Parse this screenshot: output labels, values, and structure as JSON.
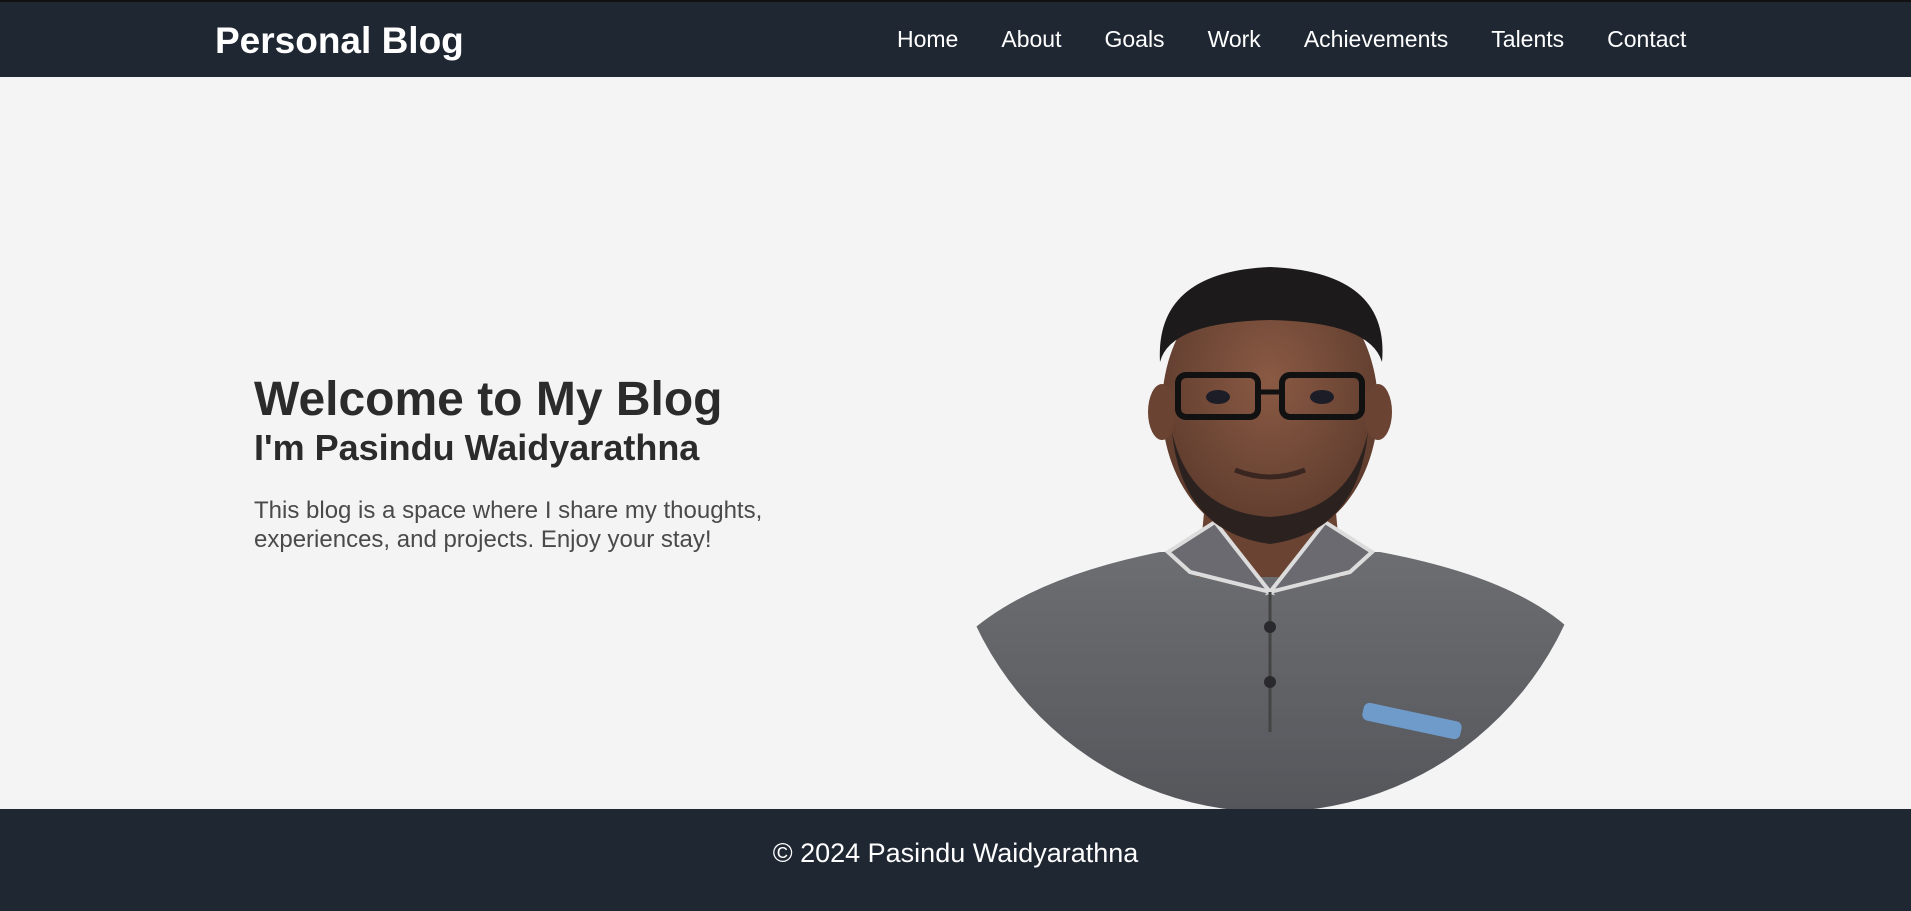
{
  "header": {
    "brand": "Personal Blog",
    "nav": [
      {
        "label": "Home"
      },
      {
        "label": "About"
      },
      {
        "label": "Goals"
      },
      {
        "label": "Work"
      },
      {
        "label": "Achievements"
      },
      {
        "label": "Talents"
      },
      {
        "label": "Contact"
      }
    ]
  },
  "hero": {
    "title": "Welcome to My Blog",
    "subtitle": "I'm Pasindu Waidyarathna",
    "description": "This blog is a space where I share my thoughts, experiences, and projects. Enjoy your stay!",
    "image_icon": "profile-photo"
  },
  "footer": {
    "copyright": "© 2024 Pasindu Waidyarathna"
  },
  "colors": {
    "nav_background": "#1f2733",
    "page_background": "#f4f4f4",
    "heading_text": "#2b2b2b",
    "body_text": "#4a4a4a"
  }
}
